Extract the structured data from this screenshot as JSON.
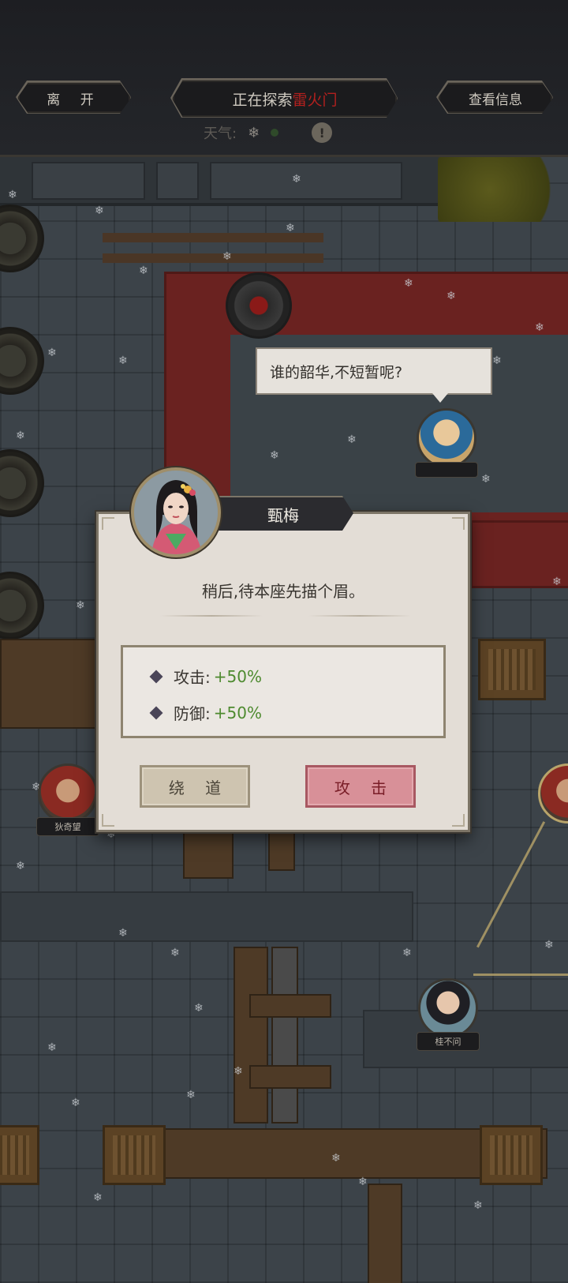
{
  "header": {
    "leave_label": "离 开",
    "explore_prefix": "正在探索",
    "explore_place": "雷火门",
    "info_label": "查看信息",
    "weather_label": "天气:",
    "weather_icon": "snowflake-icon",
    "alert_glyph": "!"
  },
  "speech": {
    "text": "谁的韶华,不短暂呢?"
  },
  "npcs": [
    {
      "name": "狄奇望"
    },
    {
      "name": "桂不问"
    }
  ],
  "dialog": {
    "name": "甄梅",
    "quote": "稍后,待本座先描个眉。",
    "stats": [
      {
        "label": "攻击:",
        "value": "+50%"
      },
      {
        "label": "防御:",
        "value": "+50%"
      }
    ],
    "detour_label": "绕 道",
    "attack_label": "攻 击"
  },
  "colors": {
    "place_red": "#b3201e",
    "stat_green": "#4d8a2f",
    "attack_button": "#d89098",
    "detour_button": "#cec4b0"
  }
}
